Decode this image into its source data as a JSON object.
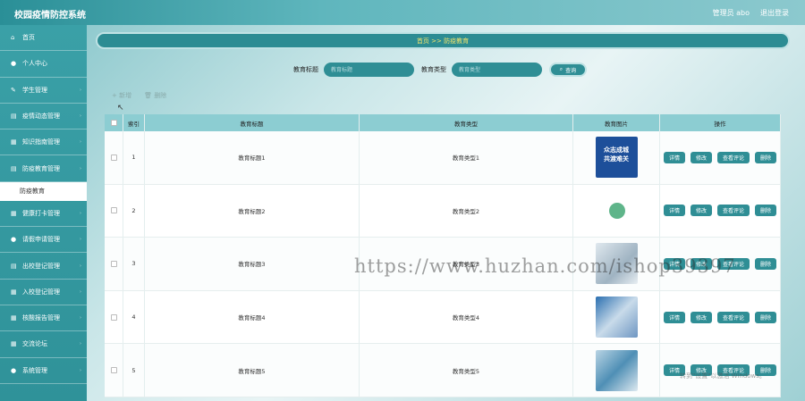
{
  "app": {
    "title": "校园疫情防控系统",
    "admin_label": "管理员 abo",
    "logout_label": "退出登录"
  },
  "sidebar": {
    "items": [
      {
        "label": "首页",
        "icon": "⌂"
      },
      {
        "label": "个人中心",
        "icon": "●"
      },
      {
        "label": "学生管理",
        "icon": "✎"
      },
      {
        "label": "疫情动态管理",
        "icon": "▤"
      },
      {
        "label": "知识指南管理",
        "icon": "▦"
      },
      {
        "label": "防疫教育管理",
        "icon": "▤"
      }
    ],
    "sub_item": "防疫教育",
    "items_after": [
      {
        "label": "健康打卡管理",
        "icon": "▦"
      },
      {
        "label": "请假申请管理",
        "icon": "●"
      },
      {
        "label": "出校登记管理",
        "icon": "▤"
      },
      {
        "label": "入校登记管理",
        "icon": "▦"
      },
      {
        "label": "核酸报告管理",
        "icon": "▦"
      },
      {
        "label": "交流论坛",
        "icon": "▦"
      },
      {
        "label": "系统管理",
        "icon": "●"
      }
    ]
  },
  "breadcrumb": "首页 >> 防疫教育",
  "search": {
    "title_label": "教育标题",
    "title_placeholder": "教育标题",
    "type_label": "教育类型",
    "type_placeholder": "教育类型",
    "button_label": "查询"
  },
  "toolbar": {
    "add_label": "新增",
    "delete_label": "删除"
  },
  "table": {
    "headers": [
      "索引",
      "教育标题",
      "教育类型",
      "教育图片",
      "操作"
    ],
    "rows": [
      {
        "index": "1",
        "title": "教育标题1",
        "type": "教育类型1",
        "image_text": "众志成城\n共渡难关"
      },
      {
        "index": "2",
        "title": "教育标题2",
        "type": "教育类型2",
        "image_text": ""
      },
      {
        "index": "3",
        "title": "教育标题3",
        "type": "教育类型3",
        "image_text": ""
      },
      {
        "index": "4",
        "title": "教育标题4",
        "type": "教育类型4",
        "image_text": ""
      },
      {
        "index": "5",
        "title": "教育标题5",
        "type": "教育类型5",
        "image_text": ""
      }
    ],
    "op_labels": {
      "detail": "详情",
      "edit": "修改",
      "comments": "查看评论",
      "delete": "删除"
    }
  },
  "watermark": "https://www.huzhan.com/ishop39397",
  "activation_text": "转到\"设置\"以激活 Windows。",
  "colors": {
    "accent": "#2f8e95",
    "header_bg": "#8ccdd2",
    "breadcrumb_text": "#f4e56c"
  }
}
